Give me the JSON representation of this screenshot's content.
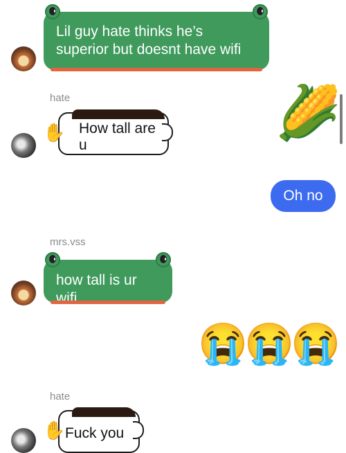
{
  "messages": [
    {
      "text": "Lil guy hate thinks he’s superior but doesnt have wifi"
    },
    {
      "sender": "hate",
      "text": "How tall are u"
    },
    {
      "text": "Oh no"
    },
    {
      "sender": "mrs.vss",
      "text": "how tall is ur wifi"
    },
    {
      "emoji": "😭"
    },
    {
      "sender": "hate",
      "text": "Fuck you"
    }
  ],
  "sticker": {
    "emoji": "🌽"
  },
  "colors": {
    "frog_green": "#3f9a5c",
    "frog_stripe": "#e5643f",
    "outgoing_blue": "#3d6bf0",
    "sender_gray": "#8a8a8a"
  }
}
